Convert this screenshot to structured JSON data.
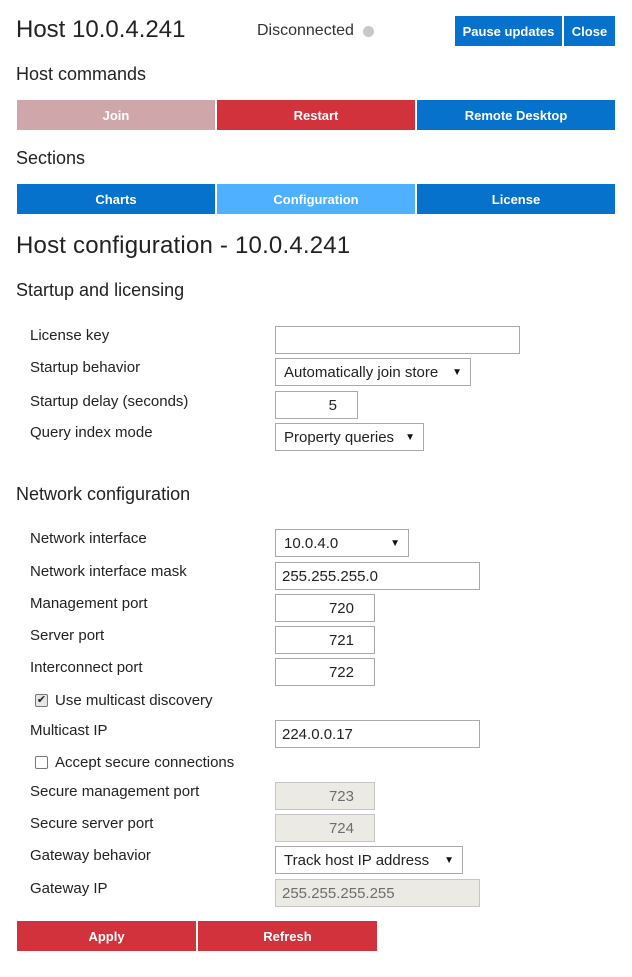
{
  "header": {
    "title": "Host 10.0.4.241",
    "status": "Disconnected",
    "status_color": "#c8c8c8",
    "pause_label": "Pause updates",
    "close_label": "Close"
  },
  "host_commands": {
    "heading": "Host commands",
    "buttons": [
      "Join",
      "Restart",
      "Remote Desktop"
    ]
  },
  "sections": {
    "heading": "Sections",
    "tabs": [
      "Charts",
      "Configuration",
      "License"
    ],
    "active": "Configuration"
  },
  "page_title": "Host configuration - 10.0.4.241",
  "startup": {
    "heading": "Startup and licensing",
    "license_key_label": "License key",
    "license_key_value": "",
    "startup_behavior_label": "Startup behavior",
    "startup_behavior_value": "Automatically join store",
    "startup_delay_label": "Startup delay (seconds)",
    "startup_delay_value": "5",
    "query_index_label": "Query index mode",
    "query_index_value": "Property queries"
  },
  "network": {
    "heading": "Network configuration",
    "interface_label": "Network interface",
    "interface_value": "10.0.4.0",
    "mask_label": "Network interface mask",
    "mask_value": "255.255.255.0",
    "mgmt_port_label": "Management port",
    "mgmt_port_value": "720",
    "server_port_label": "Server port",
    "server_port_value": "721",
    "interconnect_label": "Interconnect port",
    "interconnect_value": "722",
    "multicast_discovery_label": "Use multicast discovery",
    "multicast_discovery_checked": true,
    "multicast_ip_label": "Multicast IP",
    "multicast_ip_value": "224.0.0.17",
    "secure_conn_label": "Accept secure connections",
    "secure_conn_checked": false,
    "secure_mgmt_label": "Secure management port",
    "secure_mgmt_value": "723",
    "secure_server_label": "Secure server port",
    "secure_server_value": "724",
    "gateway_behavior_label": "Gateway behavior",
    "gateway_behavior_value": "Track host IP address",
    "gateway_ip_label": "Gateway IP",
    "gateway_ip_value": "255.255.255.255"
  },
  "actions": {
    "apply_label": "Apply",
    "refresh_label": "Refresh"
  },
  "colors": {
    "primary_blue": "#0672cb",
    "active_tab": "#4fb0ff",
    "red": "#d1323b",
    "disabled_red": "#cfa6a9"
  },
  "icons": {
    "checkbox_checked": "checkmark-icon",
    "select_arrow": "caret-down-icon"
  }
}
